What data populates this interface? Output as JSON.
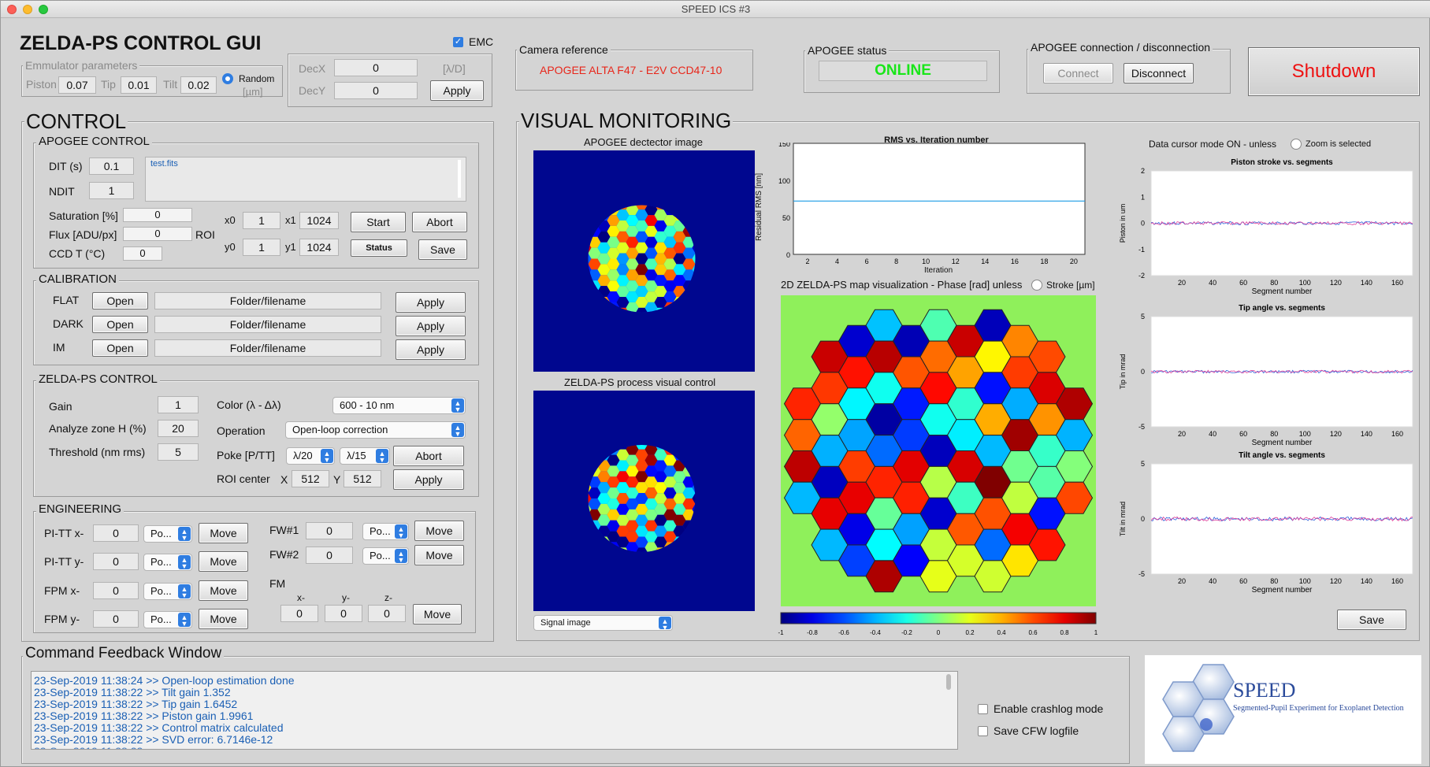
{
  "window": {
    "title": "SPEED ICS #3"
  },
  "header": {
    "app_title": "ZELDA-PS CONTROL GUI",
    "emc_label": "EMC",
    "emulator": {
      "legend": "Emmulator parameters",
      "piston_label": "Piston",
      "piston_value": "0.07",
      "tip_label": "Tip",
      "tip_value": "0.01",
      "tilt_label": "Tilt",
      "tilt_value": "0.02",
      "random_label": "Random",
      "unit": "[µm]"
    },
    "dec": {
      "decx_label": "DecX",
      "decx_value": "0",
      "decy_label": "DecY",
      "decy_value": "0",
      "unit": "[λ/D]",
      "apply": "Apply"
    },
    "camera": {
      "legend": "Camera reference",
      "value": "APOGEE ALTA F47 - E2V CCD47-10"
    },
    "status": {
      "legend": "APOGEE status",
      "value": "ONLINE"
    },
    "connection": {
      "legend": "APOGEE connection / disconnection",
      "connect": "Connect",
      "disconnect": "Disconnect"
    },
    "shutdown": "Shutdown"
  },
  "control": {
    "title": "CONTROL",
    "apogee": {
      "legend": "APOGEE CONTROL",
      "dit_label": "DIT (s)",
      "dit_value": "0.1",
      "ndit_label": "NDIT",
      "ndit_value": "1",
      "filename": "test.fits",
      "saturation_label": "Saturation [%]",
      "saturation_value": "0",
      "flux_label": "Flux [ADU/px]",
      "flux_value": "0",
      "ccdt_label": "CCD T (°C)",
      "ccdt_value": "0",
      "roi_label": "ROI",
      "x0_label": "x0",
      "x0_value": "1",
      "x1_label": "x1",
      "x1_value": "1024",
      "y0_label": "y0",
      "y0_value": "1",
      "y1_label": "y1",
      "y1_value": "1024",
      "start": "Start",
      "abort": "Abort",
      "status": "Status",
      "save": "Save"
    },
    "calibration": {
      "legend": "CALIBRATION",
      "rows": [
        {
          "label": "FLAT",
          "open": "Open",
          "path": "Folder/filename",
          "apply": "Apply"
        },
        {
          "label": "DARK",
          "open": "Open",
          "path": "Folder/filename",
          "apply": "Apply"
        },
        {
          "label": "IM",
          "open": "Open",
          "path": "Folder/filename",
          "apply": "Apply"
        }
      ]
    },
    "zelda": {
      "legend": "ZELDA-PS CONTROL",
      "gain_label": "Gain",
      "gain_value": "1",
      "zone_label": "Analyze zone H (%)",
      "zone_value": "20",
      "thr_label": "Threshold (nm rms)",
      "thr_value": "5",
      "color_label": "Color (λ - Δλ)",
      "color_value": "600 - 10 nm",
      "operation_label": "Operation",
      "operation_value": "Open-loop correction",
      "poke_label": "Poke [P/TT]",
      "poke_p": "λ/20",
      "poke_tt": "λ/15",
      "abort": "Abort",
      "roi_label": "ROI center",
      "roi_x_label": "X",
      "roi_x": "512",
      "roi_y_label": "Y",
      "roi_y": "512",
      "apply": "Apply"
    },
    "engineering": {
      "legend": "ENGINEERING",
      "rows": [
        {
          "label": "PI-TT x-",
          "value": "0",
          "sel": "Po...",
          "move": "Move"
        },
        {
          "label": "PI-TT y-",
          "value": "0",
          "sel": "Po...",
          "move": "Move"
        },
        {
          "label": "FPM x-",
          "value": "0",
          "sel": "Po...",
          "move": "Move"
        },
        {
          "label": "FPM y-",
          "value": "0",
          "sel": "Po...",
          "move": "Move"
        }
      ],
      "fw": [
        {
          "label": "FW#1",
          "value": "0",
          "sel": "Po...",
          "move": "Move"
        },
        {
          "label": "FW#2",
          "value": "0",
          "sel": "Po...",
          "move": "Move"
        }
      ],
      "fm_label": "FM",
      "fm_x_label": "x-",
      "fm_y_label": "y-",
      "fm_z_label": "z-",
      "fm_x": "0",
      "fm_y": "0",
      "fm_z": "0",
      "fm_move": "Move"
    }
  },
  "monitoring": {
    "title": "VISUAL MONITORING",
    "apogee_img_title": "APOGEE dectector image",
    "zelda_img_title": "ZELDA-PS process visual control",
    "signal_select": "Signal image",
    "rms_title": "RMS vs. Iteration number",
    "rms_xlabel": "Iteration",
    "rms_ylabel": "Residual RMS [nm]",
    "rms_xticks": [
      "2",
      "4",
      "6",
      "8",
      "10",
      "12",
      "14",
      "16",
      "18",
      "20"
    ],
    "rms_yticks": [
      "150",
      "100",
      "50",
      "0"
    ],
    "map_title": "2D ZELDA-PS map visualization - Phase [rad] unless",
    "stroke_label": "Stroke [µm]",
    "colorbar_ticks": [
      "-1",
      "-0.8",
      "-0.6",
      "-0.4",
      "-0.2",
      "0",
      "0.2",
      "0.4",
      "0.6",
      "0.8",
      "1"
    ],
    "cursor_label": "Data cursor mode ON - unless",
    "zoom_label": "Zoom is selected",
    "seg_xticks": [
      "20",
      "40",
      "60",
      "80",
      "100",
      "120",
      "140",
      "160"
    ],
    "piston": {
      "title": "Piston stroke vs. segments",
      "ylabel": "Piston in um",
      "xlabel": "Segment number",
      "yticks": [
        "2",
        "1",
        "0",
        "-1",
        "-2"
      ]
    },
    "tip": {
      "title": "Tip angle vs. segments",
      "ylabel": "Tip in mrad",
      "xlabel": "Segment number",
      "yticks": [
        "5",
        "0",
        "-5"
      ]
    },
    "tilt": {
      "title": "Tilt angle vs. segments",
      "ylabel": "Tilt in mrad",
      "xlabel": "Segment number",
      "yticks": [
        "5",
        "0",
        "-5"
      ]
    },
    "save": "Save"
  },
  "feedback": {
    "title": "Command Feedback Window",
    "lines": [
      "23-Sep-2019 11:38:24 >> Open-loop estimation done",
      "23-Sep-2019 11:38:22 >> Tilt gain  1.352",
      "23-Sep-2019 11:38:22 >> Tip gain  1.6452",
      "23-Sep-2019 11:38:22 >> Piston gain  1.9961",
      "23-Sep-2019 11:38:22 >> Control matrix calculated",
      "23-Sep-2019 11:38:22 >> SVD error:  6.7146e-12"
    ],
    "crashlog": "Enable crashlog mode",
    "cfw": "Save CFW logfile"
  },
  "logo": {
    "name": "SPEED",
    "subtitle": "Segmented-Pupil Experiment for Exoplanet Detection"
  },
  "colors": {
    "online": "#19e619",
    "camera": "#e8261a",
    "shutdown": "#ee1111",
    "accent": "#2f7de1"
  }
}
